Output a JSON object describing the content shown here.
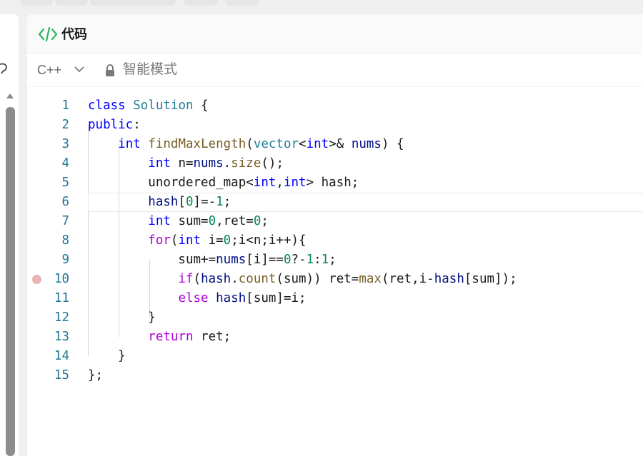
{
  "panel": {
    "title": "代码",
    "language": "C++",
    "mode_label": "智能模式"
  },
  "editor": {
    "breakpoint_line": 10,
    "current_line": 6,
    "lines": [
      {
        "n": "1",
        "tokens": [
          [
            "kw",
            "class"
          ],
          [
            "pl",
            " "
          ],
          [
            "ty",
            "Solution"
          ],
          [
            "pl",
            " {"
          ]
        ]
      },
      {
        "n": "2",
        "tokens": [
          [
            "kw",
            "public"
          ],
          [
            "pl",
            ":"
          ]
        ]
      },
      {
        "n": "3",
        "tokens": [
          [
            "pl",
            "    "
          ],
          [
            "kw",
            "int"
          ],
          [
            "pl",
            " "
          ],
          [
            "fn",
            "findMaxLength"
          ],
          [
            "pl",
            "("
          ],
          [
            "ty",
            "vector"
          ],
          [
            "pl",
            "<"
          ],
          [
            "kw",
            "int"
          ],
          [
            "pl",
            ">& "
          ],
          [
            "var",
            "nums"
          ],
          [
            "pl",
            ") {"
          ]
        ]
      },
      {
        "n": "4",
        "tokens": [
          [
            "pl",
            "        "
          ],
          [
            "kw",
            "int"
          ],
          [
            "pl",
            " n="
          ],
          [
            "var",
            "nums"
          ],
          [
            "pl",
            "."
          ],
          [
            "fn",
            "size"
          ],
          [
            "pl",
            "();"
          ]
        ]
      },
      {
        "n": "5",
        "tokens": [
          [
            "pl",
            "        unordered_map<"
          ],
          [
            "kw",
            "int"
          ],
          [
            "pl",
            ","
          ],
          [
            "kw",
            "int"
          ],
          [
            "pl",
            "> hash;"
          ]
        ]
      },
      {
        "n": "6",
        "tokens": [
          [
            "pl",
            "        "
          ],
          [
            "var",
            "hash"
          ],
          [
            "pl",
            "["
          ],
          [
            "num",
            "0"
          ],
          [
            "pl",
            "]=-"
          ],
          [
            "num",
            "1"
          ],
          [
            "pl",
            ";"
          ]
        ]
      },
      {
        "n": "7",
        "tokens": [
          [
            "pl",
            "        "
          ],
          [
            "kw",
            "int"
          ],
          [
            "pl",
            " sum="
          ],
          [
            "num",
            "0"
          ],
          [
            "pl",
            ",ret="
          ],
          [
            "num",
            "0"
          ],
          [
            "pl",
            ";"
          ]
        ]
      },
      {
        "n": "8",
        "tokens": [
          [
            "pl",
            "        "
          ],
          [
            "ctl",
            "for"
          ],
          [
            "pl",
            "("
          ],
          [
            "kw",
            "int"
          ],
          [
            "pl",
            " i="
          ],
          [
            "num",
            "0"
          ],
          [
            "pl",
            ";i<n;i++){"
          ]
        ]
      },
      {
        "n": "9",
        "tokens": [
          [
            "pl",
            "            sum+="
          ],
          [
            "var",
            "nums"
          ],
          [
            "pl",
            "[i]=="
          ],
          [
            "num",
            "0"
          ],
          [
            "pl",
            "?-"
          ],
          [
            "num",
            "1"
          ],
          [
            "pl",
            ":"
          ],
          [
            "num",
            "1"
          ],
          [
            "pl",
            ";"
          ]
        ]
      },
      {
        "n": "10",
        "tokens": [
          [
            "pl",
            "            "
          ],
          [
            "ctl",
            "if"
          ],
          [
            "pl",
            "("
          ],
          [
            "var",
            "hash"
          ],
          [
            "pl",
            "."
          ],
          [
            "fn",
            "count"
          ],
          [
            "pl",
            "(sum)) ret="
          ],
          [
            "fn",
            "max"
          ],
          [
            "pl",
            "(ret,i-"
          ],
          [
            "var",
            "hash"
          ],
          [
            "pl",
            "[sum]);"
          ]
        ]
      },
      {
        "n": "11",
        "tokens": [
          [
            "pl",
            "            "
          ],
          [
            "ctl",
            "else"
          ],
          [
            "pl",
            " "
          ],
          [
            "var",
            "hash"
          ],
          [
            "pl",
            "[sum]=i;"
          ]
        ]
      },
      {
        "n": "12",
        "tokens": [
          [
            "pl",
            "        }"
          ]
        ]
      },
      {
        "n": "13",
        "tokens": [
          [
            "pl",
            "        "
          ],
          [
            "ctl",
            "return"
          ],
          [
            "pl",
            " ret;"
          ]
        ]
      },
      {
        "n": "14",
        "tokens": [
          [
            "pl",
            "    }"
          ]
        ]
      },
      {
        "n": "15",
        "tokens": [
          [
            "pl",
            "};"
          ]
        ]
      }
    ]
  },
  "colors": {
    "keyword": "#0000ff",
    "type": "#267f99",
    "function": "#795e26",
    "control": "#af00db",
    "variable": "#001080",
    "number": "#098658",
    "line_number": "#237893",
    "accent_green": "#2db55d"
  },
  "icons": {
    "code": "code-icon",
    "chevron": "chevron-down-icon",
    "lock": "lock-icon"
  }
}
